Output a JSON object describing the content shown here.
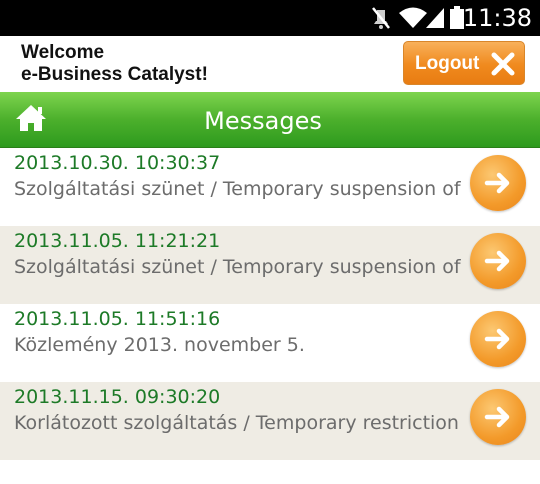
{
  "status_bar": {
    "time": "11:38",
    "icons": [
      "mute-icon",
      "wifi-icon",
      "signal-icon",
      "battery-icon"
    ]
  },
  "header": {
    "welcome_line1": "Welcome",
    "welcome_line2": "e-Business Catalyst!",
    "logout_label": "Logout"
  },
  "title_bar": {
    "title": "Messages",
    "home_icon": "home-icon"
  },
  "messages": [
    {
      "date": "2013.10.30. 10:30:37",
      "subject": "Szolgáltatási szünet / Temporary suspension of IB"
    },
    {
      "date": "2013.11.05. 11:21:21",
      "subject": "Szolgáltatási szünet / Temporary suspension of IB"
    },
    {
      "date": "2013.11.05. 11:51:16",
      "subject": "Közlemény 2013. november 5."
    },
    {
      "date": "2013.11.15. 09:30:20",
      "subject": "Korlátozott szolgáltatás / Temporary restriction"
    }
  ],
  "colors": {
    "row_alt_bg": "#efece4",
    "date_green": "#1d7a27",
    "accent_orange": "#f08a1e",
    "titlebar_green": "#4cb02c"
  }
}
